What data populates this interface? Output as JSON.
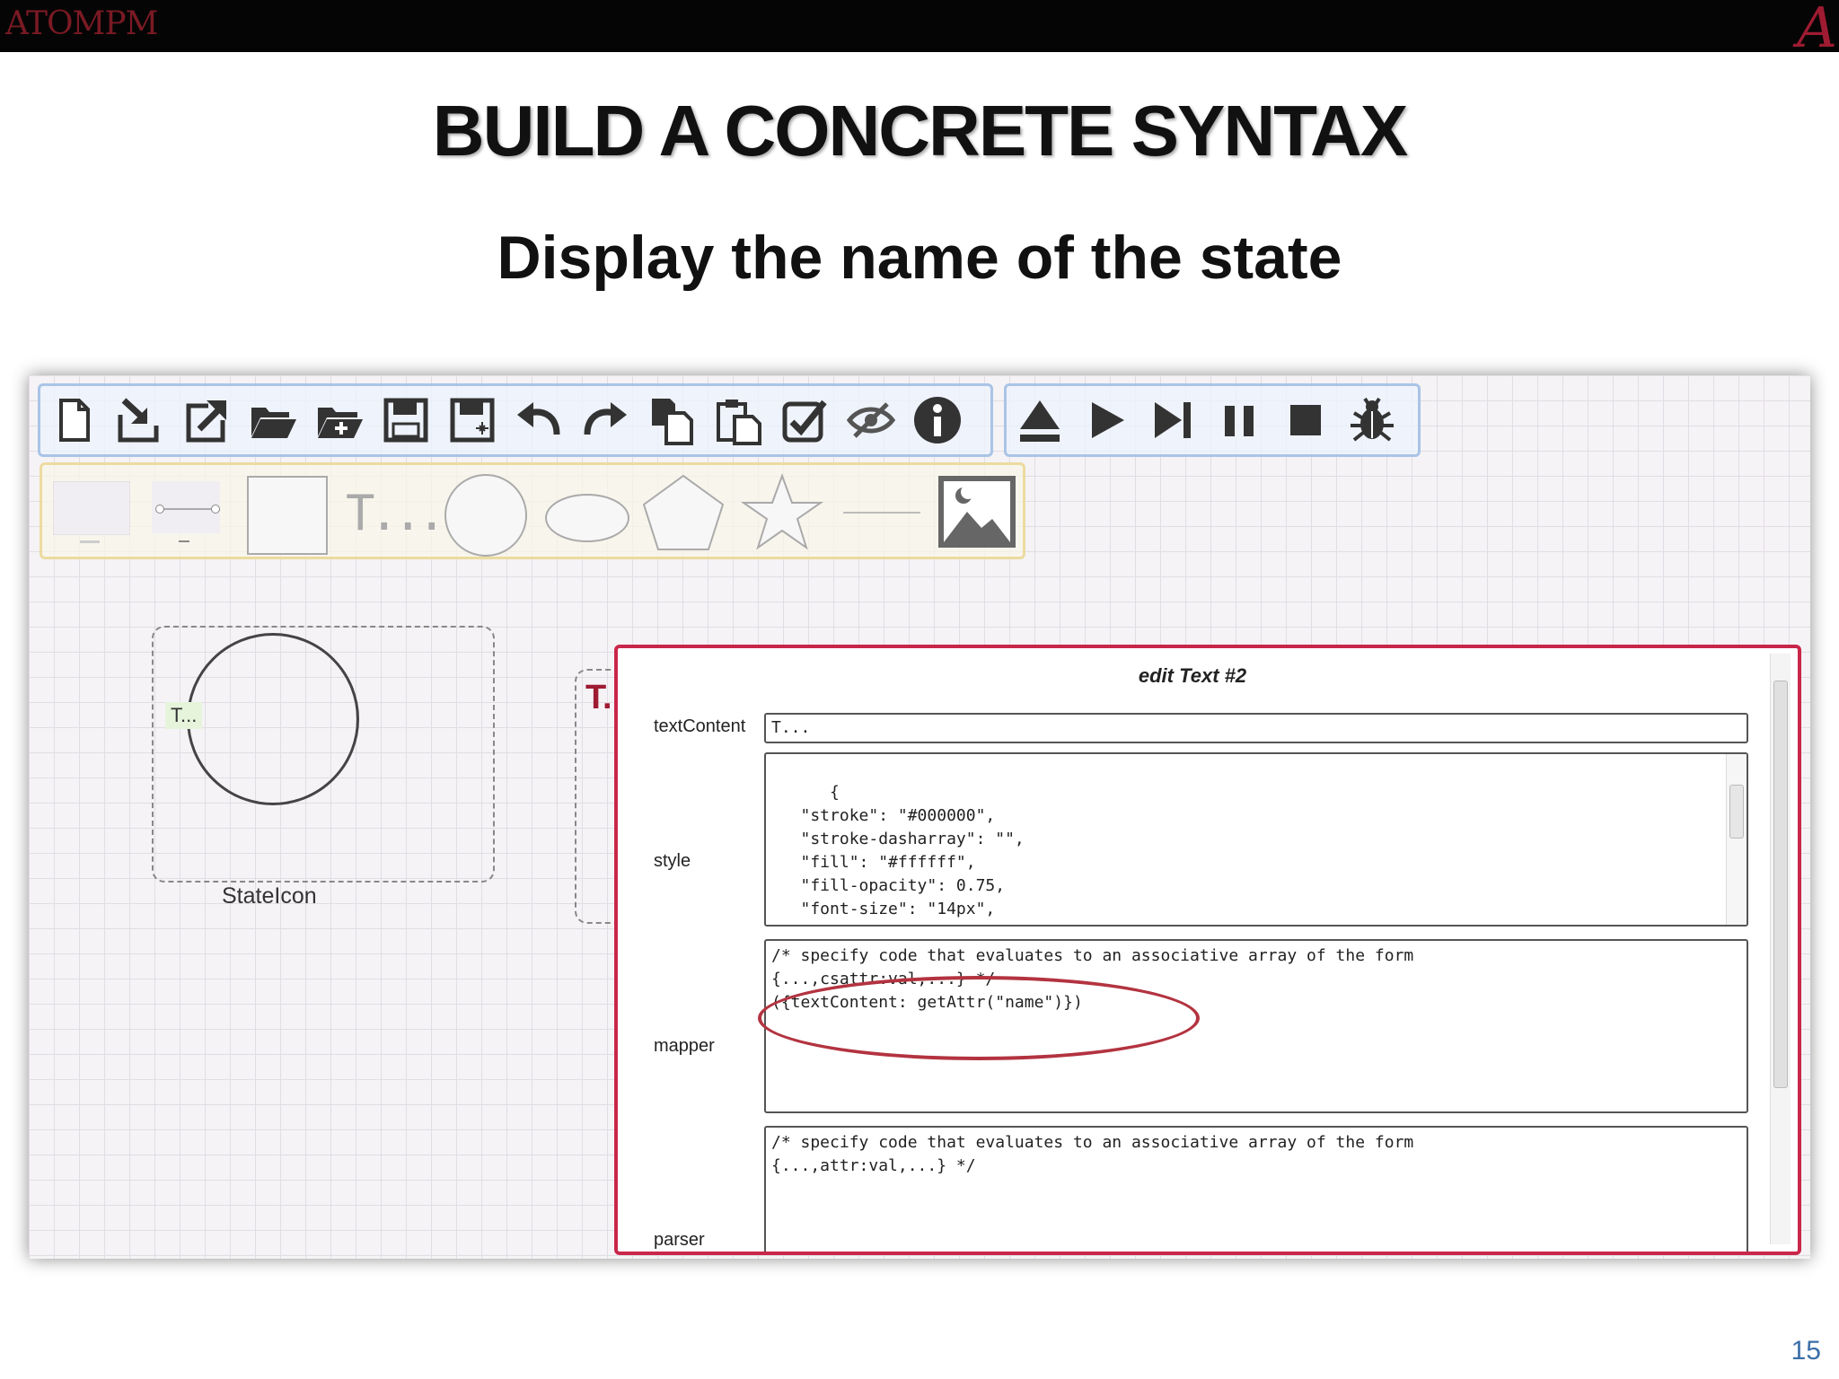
{
  "header": {
    "logo": "ATOMPM",
    "corner_logo": "A"
  },
  "title": "BUILD A CONCRETE SYNTAX",
  "subtitle": "Display the name of the state",
  "page_number": "15",
  "toolbar_file": {
    "icons": [
      "new-file-icon",
      "import-icon",
      "export-icon",
      "open-folder-icon",
      "new-folder-icon",
      "save-icon",
      "save-as-icon",
      "undo-icon",
      "redo-icon",
      "copy-icon",
      "paste-icon",
      "validate-icon",
      "hide-icon",
      "info-icon"
    ]
  },
  "toolbar_run": {
    "icons": [
      "eject-icon",
      "play-icon",
      "step-icon",
      "pause-icon",
      "stop-icon",
      "debug-bug-icon"
    ]
  },
  "shape_toolbar": {
    "items": [
      "icon-shape",
      "link-shape",
      "rectangle-shape",
      "text-shape",
      "circle-shape",
      "ellipse-shape",
      "polygon-shape",
      "star-shape",
      "line-shape",
      "image-shape"
    ],
    "text_tool_label": "T..."
  },
  "diagram": {
    "state_text": "T...",
    "state_label": "StateIcon",
    "second_text": "T."
  },
  "dialog": {
    "title": "edit Text #2",
    "textContent_label": "textContent",
    "textContent_value": "T...",
    "style_label": "style",
    "style_value": "{\n   \"stroke\": \"#000000\",\n   \"stroke-dasharray\": \"\",\n   \"fill\": \"#ffffff\",\n   \"fill-opacity\": 0.75,\n   \"font-size\": \"14px\",\n   \"arrow-start\": \"none\",",
    "mapper_label": "mapper",
    "mapper_value": "/* specify code that evaluates to an associative array of the form\n{...,csattr:val,...} */\n({textContent: getAttr(\"name\")})",
    "parser_label": "parser",
    "parser_value": "/* specify code that evaluates to an associative array of the form\n{...,attr:val,...} */"
  },
  "colors": {
    "accent": "#c9274a",
    "highlight": "#b33340",
    "brand": "#9e1b32"
  }
}
